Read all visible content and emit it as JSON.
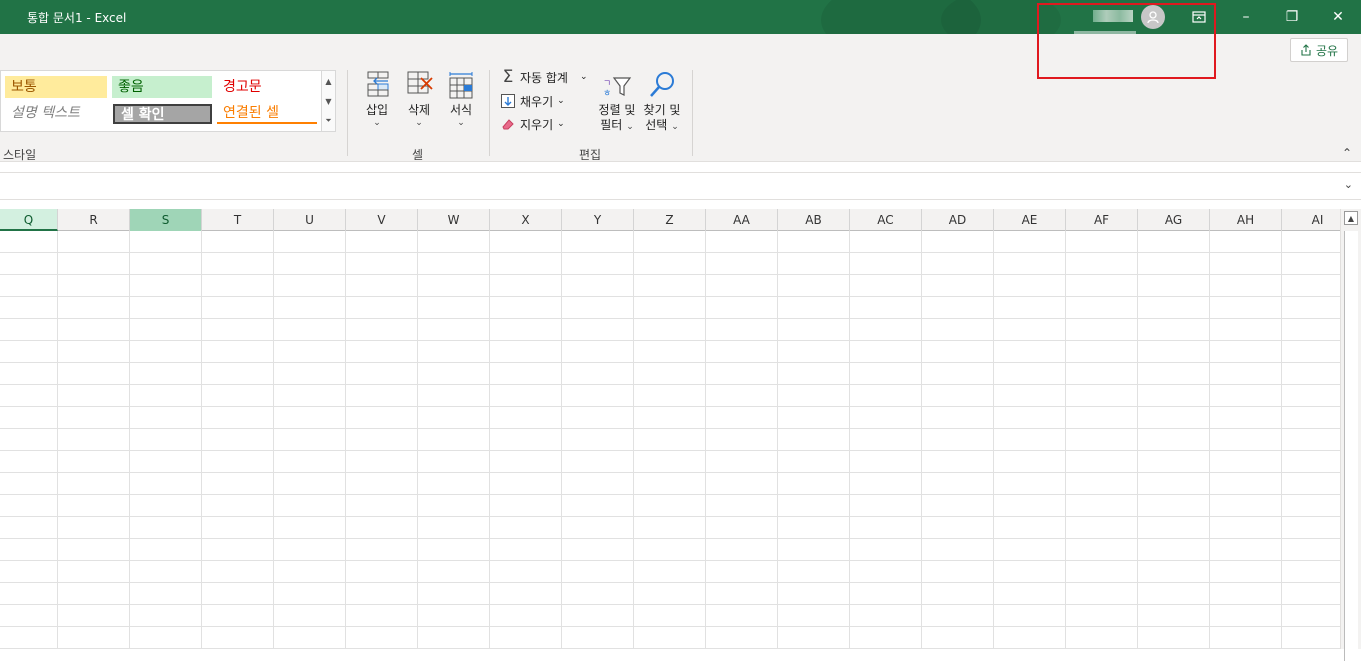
{
  "window": {
    "title": "통합 문서1  -  Excel",
    "minimize_icon": "–",
    "restore_icon": "❐",
    "close_icon": "✕"
  },
  "ribbon": {
    "share_label": "공유",
    "styles": {
      "normal_bad": "보통",
      "good": "좋음",
      "warning": "경고문",
      "explanatory": "설명 텍스트",
      "check_cell": "셀 확인",
      "linked_cell": "연결된 셀",
      "group_label": "스타일"
    },
    "cells": {
      "insert": "삽입",
      "delete": "삭제",
      "format": "서식",
      "group_label": "셀"
    },
    "editing": {
      "autosum": "자동 합계",
      "fill": "채우기",
      "clear": "지우기",
      "sort_filter_line1": "정렬 및",
      "sort_filter_line2": "필터",
      "find_select_line1": "찾기 및",
      "find_select_line2": "선택",
      "group_label": "편집"
    }
  },
  "grid": {
    "columns": [
      "Q",
      "R",
      "S",
      "T",
      "U",
      "V",
      "W",
      "X",
      "Y",
      "Z",
      "AA",
      "AB",
      "AC",
      "AD",
      "AE",
      "AF",
      "AG",
      "AH",
      "AI"
    ],
    "active_column": "S"
  },
  "colors": {
    "brand": "#217346",
    "highlight_box": "#e0191f"
  }
}
